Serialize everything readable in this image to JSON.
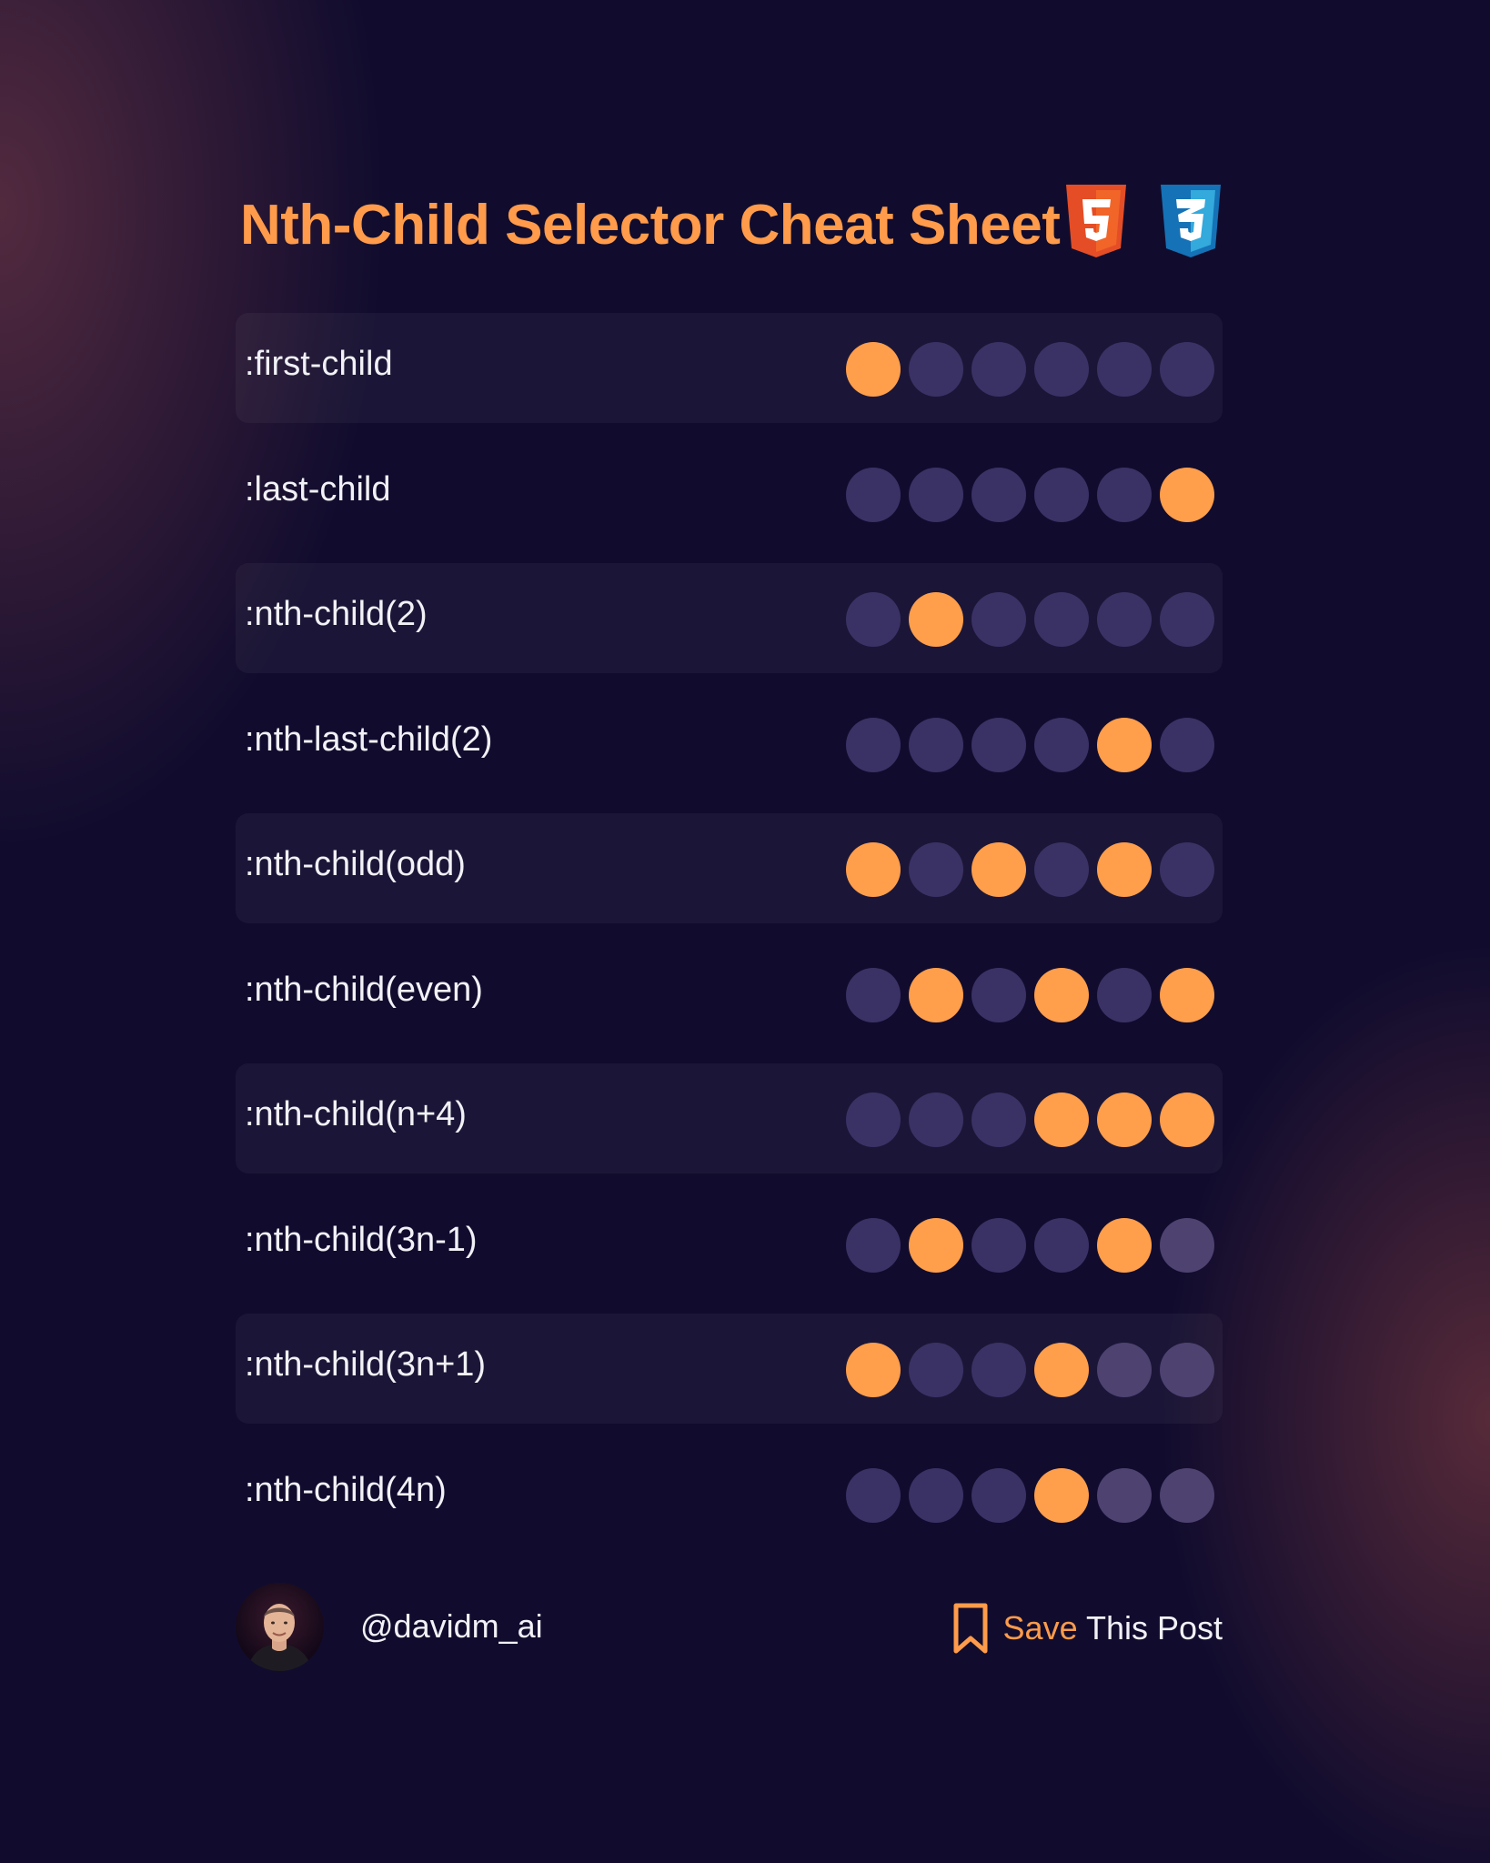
{
  "title": "Nth-Child Selector Cheat Sheet",
  "badges": [
    {
      "icon": "html5-logo-icon",
      "text": "5",
      "color": "#e44d26"
    },
    {
      "icon": "css3-logo-icon",
      "text": "3",
      "color": "#1572b6"
    }
  ],
  "colors": {
    "accent": "#ff9e4b",
    "dot_default": "#3a3265",
    "dot_faded": "#4e4271",
    "background": "#110c2e"
  },
  "rows": [
    {
      "selector": ":first-child",
      "dots": [
        1,
        0,
        0,
        0,
        0,
        0
      ]
    },
    {
      "selector": ":last-child",
      "dots": [
        0,
        0,
        0,
        0,
        0,
        1
      ]
    },
    {
      "selector": ":nth-child(2)",
      "dots": [
        0,
        1,
        0,
        0,
        0,
        0
      ]
    },
    {
      "selector": ":nth-last-child(2)",
      "dots": [
        0,
        0,
        0,
        0,
        1,
        0
      ]
    },
    {
      "selector": ":nth-child(odd)",
      "dots": [
        1,
        0,
        1,
        0,
        1,
        0
      ]
    },
    {
      "selector": ":nth-child(even)",
      "dots": [
        0,
        1,
        0,
        1,
        0,
        1
      ]
    },
    {
      "selector": ":nth-child(n+4)",
      "dots": [
        0,
        0,
        0,
        1,
        1,
        1
      ]
    },
    {
      "selector": ":nth-child(3n-1)",
      "dots": [
        0,
        1,
        0,
        0,
        1,
        2
      ]
    },
    {
      "selector": ":nth-child(3n+1)",
      "dots": [
        1,
        0,
        0,
        1,
        2,
        2
      ]
    },
    {
      "selector": ":nth-child(4n)",
      "dots": [
        0,
        0,
        0,
        1,
        2,
        2
      ]
    }
  ],
  "footer": {
    "handle": "@davidm_ai",
    "save_highlight": "Save",
    "save_rest": "This Post",
    "bookmark_icon": "bookmark-icon"
  }
}
